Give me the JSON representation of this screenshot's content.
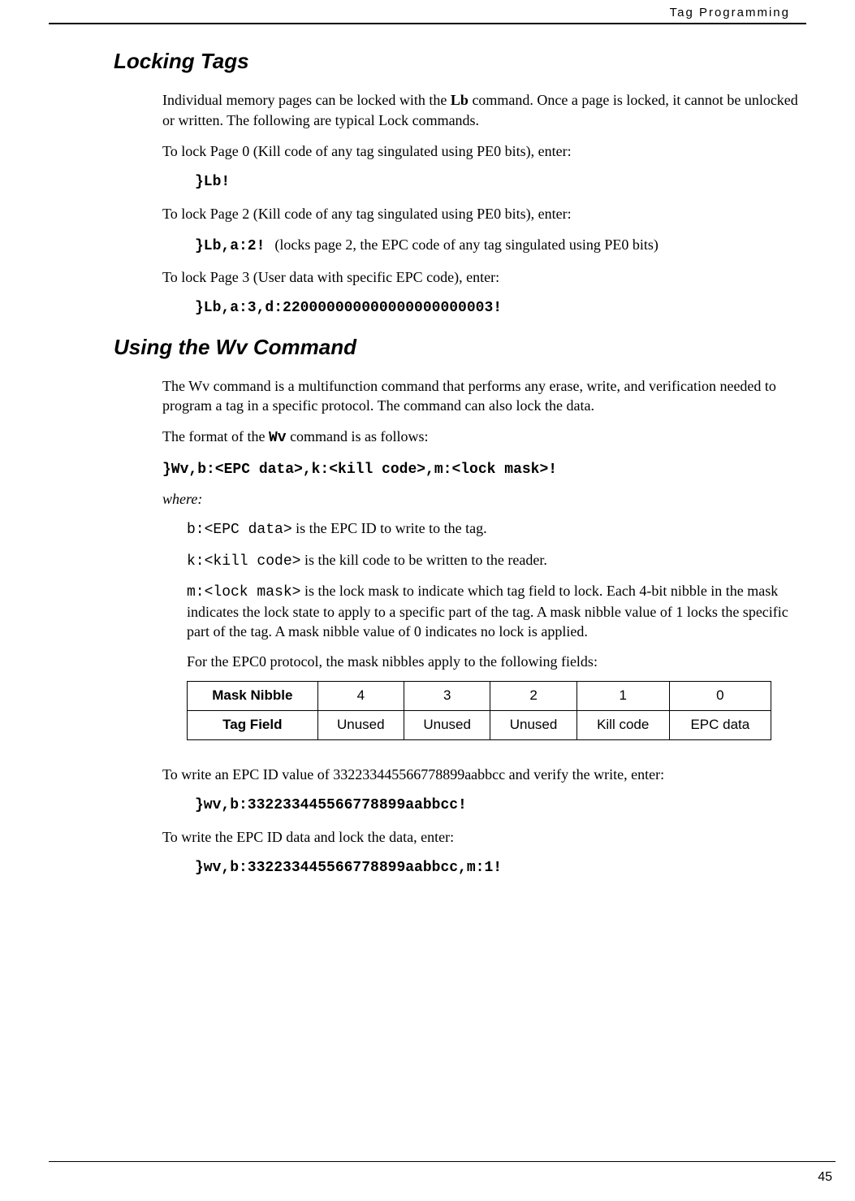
{
  "header": {
    "running_title": "Tag Programming",
    "page_number": "45"
  },
  "section1": {
    "title": "Locking Tags",
    "p1_pre": "Individual memory pages can be locked with the ",
    "p1_bold": "Lb",
    "p1_post": " command. Once a page is locked, it cannot be unlocked or written. The following are typical Lock commands.",
    "p2": "To lock Page 0 (Kill code of any tag singulated using PE0 bits), enter:",
    "code1": "}Lb!",
    "p3": "To lock Page 2 (Kill code of any tag singulated using PE0 bits), enter:",
    "code2": "}Lb,a:2!",
    "code2_aside": "(locks page 2, the EPC code of any tag singulated using PE0 bits)",
    "p4": "To lock Page 3 (User data with specific EPC code), enter:",
    "code3": "}Lb,a:3,d:220000000000000000000003!"
  },
  "section2": {
    "title": "Using the Wv Command",
    "p1": "The Wv command is a multifunction command that performs any erase, write, and verification needed to program a tag in a specific protocol. The command can also lock the data.",
    "p2_pre": "The format of the ",
    "p2_code": "Wv",
    "p2_post": " command is as follows:",
    "syntax": "}Wv,b:<EPC data>,k:<kill code>,m:<lock mask>!",
    "where": "where:",
    "def1_code": "b:<EPC data>",
    "def1_text": " is the EPC ID to write to the tag.",
    "def2_code": "k:<kill code>",
    "def2_text": " is the kill code to be written to the reader.",
    "def3_code": "m:<lock mask>",
    "def3_text": " is the lock mask to indicate which tag field to lock. Each 4-bit nibble in the mask indicates the lock state to apply to a specific part of the tag. A mask nibble value of 1 locks the specific part of the tag. A mask nibble value of 0 indicates no lock is applied.",
    "p3": "For the EPC0 protocol, the mask nibbles apply to the following fields:",
    "table": {
      "row1": [
        "Mask Nibble",
        "4",
        "3",
        "2",
        "1",
        "0"
      ],
      "row2": [
        "Tag Field",
        "Unused",
        "Unused",
        "Unused",
        "Kill code",
        "EPC data"
      ]
    },
    "p4": "To write an EPC ID value of 332233445566778899aabbcc and verify the write, enter:",
    "code4": "}wv,b:332233445566778899aabbcc!",
    "p5": "To write the EPC ID data and lock the data, enter:",
    "code5": "}wv,b:332233445566778899aabbcc,m:1!"
  }
}
